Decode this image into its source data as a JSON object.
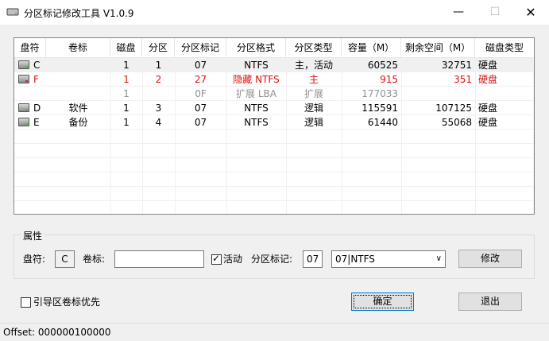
{
  "window": {
    "title": "分区标记修改工具 V1.0.9",
    "minimize": "—",
    "maximize": "☐",
    "close": "✕"
  },
  "table": {
    "columns": [
      "盘符",
      "卷标",
      "磁盘",
      "分区",
      "分区标记",
      "分区格式",
      "分区类型",
      "容量（M）",
      "剩余空间（M）",
      "磁盘类型"
    ],
    "rows": [
      {
        "drive": "C",
        "label": "",
        "disk": "1",
        "part": "1",
        "mark": "07",
        "fs": "NTFS",
        "type": "主，活动",
        "size": "60525",
        "free": "32751",
        "dtype": "硬盘"
      },
      {
        "drive": "F",
        "label": "",
        "disk": "1",
        "part": "2",
        "mark": "27",
        "fs": "隐藏 NTFS",
        "type": "主",
        "size": "915",
        "free": "351",
        "dtype": "硬盘"
      },
      {
        "drive": "",
        "label": "",
        "disk": "1",
        "part": "",
        "mark": "0F",
        "fs": "扩展 LBA",
        "type": "扩展",
        "size": "177033",
        "free": "",
        "dtype": ""
      },
      {
        "drive": "D",
        "label": "软件",
        "disk": "1",
        "part": "3",
        "mark": "07",
        "fs": "NTFS",
        "type": "逻辑",
        "size": "115591",
        "free": "107125",
        "dtype": "硬盘"
      },
      {
        "drive": "E",
        "label": "备份",
        "disk": "1",
        "part": "4",
        "mark": "07",
        "fs": "NTFS",
        "type": "逻辑",
        "size": "61440",
        "free": "55068",
        "dtype": "硬盘"
      }
    ]
  },
  "properties": {
    "group_label": "属性",
    "drive_label": "盘符:",
    "drive_value": "C",
    "volume_label": "卷标:",
    "volume_value": "",
    "active_label": "活动",
    "active_checked": true,
    "mark_label": "分区标记:",
    "mark_value": "07",
    "fs_select": "07|NTFS",
    "modify_button": "修改"
  },
  "boot_priority_label": "引导区卷标优先",
  "ok_button": "确定",
  "exit_button": "退出",
  "status": "Offset: 000000100000",
  "colors": {
    "accent_red": "#e01010",
    "disabled_gray": "#909090"
  }
}
